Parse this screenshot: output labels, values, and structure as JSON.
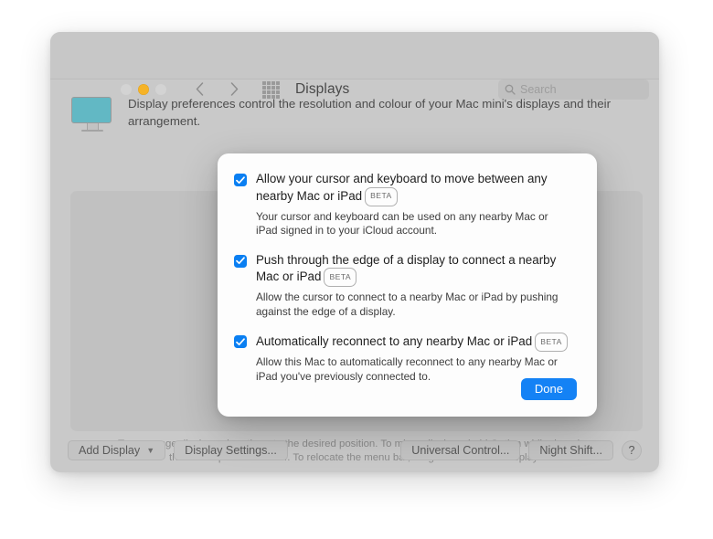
{
  "window": {
    "title": "Displays",
    "traffic_lights": [
      "close",
      "minimize",
      "zoom"
    ],
    "search": {
      "placeholder": "Search",
      "value": ""
    }
  },
  "main": {
    "description": "Display preferences control the resolution and colour of your Mac mini's displays and their arrangement.",
    "hint": "To rearrange displays, drag them to the desired position. To mirror displays, hold Option while dragging them on top of each other. To relocate the menu bar, drag it to a different display."
  },
  "bottom_bar": {
    "add_display": "Add Display",
    "display_settings": "Display Settings...",
    "universal_control": "Universal Control...",
    "night_shift": "Night Shift...",
    "help": "?"
  },
  "dialog": {
    "options": [
      {
        "checked": true,
        "title": "Allow your cursor and keyboard to move between any nearby Mac or iPad",
        "badge": "BETA",
        "subtitle": "Your cursor and keyboard can be used on any nearby Mac or iPad signed in to your iCloud account."
      },
      {
        "checked": true,
        "title": "Push through the edge of a display to connect a nearby Mac or iPad",
        "badge": "BETA",
        "subtitle": "Allow the cursor to connect to a nearby Mac or iPad by pushing against the edge of a display."
      },
      {
        "checked": true,
        "title": "Automatically reconnect to any nearby Mac or iPad",
        "badge": "BETA",
        "subtitle": "Allow this Mac to automatically reconnect to any nearby Mac or iPad you've previously connected to."
      }
    ],
    "done_label": "Done"
  },
  "colors": {
    "accent": "#1482f5",
    "checkbox": "#0a7ff2",
    "display_icon": "#62b8c4",
    "minimize_light": "#f6b327"
  }
}
